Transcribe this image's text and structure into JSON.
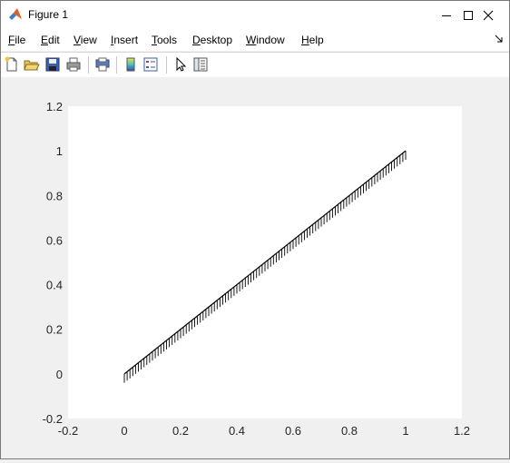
{
  "window": {
    "title": "Figure 1"
  },
  "menu": {
    "items": [
      {
        "label": "File",
        "mnemonic": "F",
        "rest": "ile"
      },
      {
        "label": "Edit",
        "mnemonic": "E",
        "rest": "dit"
      },
      {
        "label": "View",
        "mnemonic": "V",
        "rest": "iew"
      },
      {
        "label": "Insert",
        "mnemonic": "I",
        "rest": "nsert"
      },
      {
        "label": "Tools",
        "mnemonic": "T",
        "rest": "ools"
      },
      {
        "label": "Desktop",
        "mnemonic": "D",
        "rest": "esktop"
      },
      {
        "label": "Window",
        "mnemonic": "W",
        "rest": "indow"
      },
      {
        "label": "Help",
        "mnemonic": "H",
        "rest": "elp"
      }
    ]
  },
  "toolbar": {
    "icons": [
      "new-figure-icon",
      "open-file-icon",
      "save-icon",
      "print-icon",
      "print-preview-icon",
      "colorbar-icon",
      "legend-icon",
      "edit-plot-icon",
      "property-inspector-icon"
    ]
  },
  "chart_data": {
    "type": "line",
    "x": [
      0,
      1
    ],
    "y": [
      0,
      1
    ],
    "tick_marks_below_line": true,
    "tick_mark_length": 0.04,
    "tick_mark_count": 100,
    "xlim": [
      -0.2,
      1.2
    ],
    "ylim": [
      -0.2,
      1.2
    ],
    "xticks": [
      "-0.2",
      "0",
      "0.2",
      "0.4",
      "0.6",
      "0.8",
      "1",
      "1.2"
    ],
    "yticks": [
      "-0.2",
      "0",
      "0.2",
      "0.4",
      "0.6",
      "0.8",
      "1",
      "1.2"
    ],
    "xtick_values": [
      -0.2,
      0,
      0.2,
      0.4,
      0.6,
      0.8,
      1,
      1.2
    ],
    "ytick_values": [
      -0.2,
      0,
      0.2,
      0.4,
      0.6,
      0.8,
      1,
      1.2
    ],
    "title": "",
    "xlabel": "",
    "ylabel": "",
    "grid": false,
    "line_color": "#000000"
  }
}
